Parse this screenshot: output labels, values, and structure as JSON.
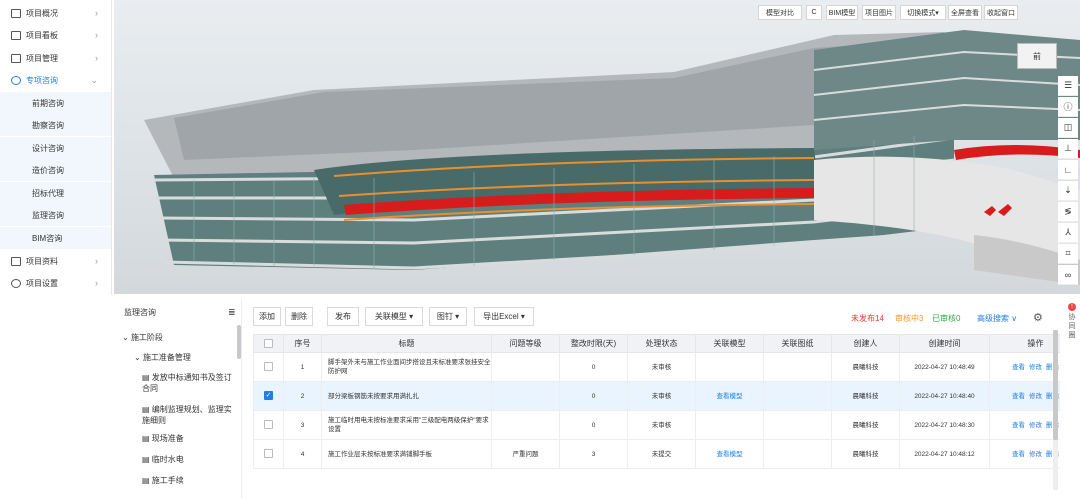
{
  "nav": {
    "items": [
      {
        "label": "项目概况",
        "icon": "building-icon"
      },
      {
        "label": "项目看板",
        "icon": "board-icon"
      },
      {
        "label": "项目管理",
        "icon": "chart-icon"
      },
      {
        "label": "专项咨询",
        "icon": "chat-icon"
      }
    ],
    "sub_items": [
      "前期咨询",
      "勘察咨询",
      "设计咨询",
      "造价咨询",
      "招标代理",
      "监理咨询",
      "BIM咨询"
    ],
    "bottom_items": [
      {
        "label": "项目资料",
        "icon": "book-icon"
      },
      {
        "label": "项目设置",
        "icon": "settings-icon"
      }
    ]
  },
  "viewer": {
    "toolbar": [
      "模型对比",
      "C",
      "BIM模型",
      "项目图片",
      "切换模式▾",
      "全屏查看",
      "收起窗口"
    ],
    "cube_label": "前"
  },
  "tree": {
    "title": "监理咨询",
    "nodes": [
      "施工阶段",
      "施工准备管理",
      "发放中标通知书及签订合同",
      "编制监理规划、监理实施细则",
      "现场准备",
      "临时水电",
      "施工手续"
    ]
  },
  "table_toolbar": {
    "buttons": [
      "添加",
      "删除",
      "发布",
      "关联模型 ▾",
      "图钉 ▾",
      "导出Excel ▾"
    ],
    "status": [
      {
        "label": "未发布14",
        "color": "#e53935"
      },
      {
        "label": "审核中3",
        "color": "#f59a23"
      },
      {
        "label": "已审核0",
        "color": "#2eaa4a"
      }
    ],
    "advanced_search": "高级搜索 ∨"
  },
  "table": {
    "headers": [
      "序号",
      "标题",
      "问题等级",
      "整改时限(天)",
      "处理状态",
      "关联模型",
      "关联图纸",
      "创建人",
      "创建时间",
      "操作"
    ],
    "rows": [
      {
        "no": "1",
        "title": "脚手架外未与施工作业面间步搭设且未标准要求张挂安全防护网",
        "level": "",
        "days": "0",
        "status": "未审核",
        "model": "",
        "drawing": "",
        "creator": "晨曦科技",
        "time": "2022-04-27 10:48:49",
        "checked": false
      },
      {
        "no": "2",
        "title": "部分梁板钢筋未按要求用满扎扎",
        "level": "",
        "days": "0",
        "status": "未审核",
        "model": "查看模型",
        "drawing": "",
        "creator": "晨曦科技",
        "time": "2022-04-27 10:48:40",
        "checked": true
      },
      {
        "no": "3",
        "title": "施工临时用电未按标准要求采用\"三级配电两级保护\"要求设置",
        "level": "",
        "days": "0",
        "status": "未审核",
        "model": "",
        "drawing": "",
        "creator": "晨曦科技",
        "time": "2022-04-27 10:48:30",
        "checked": false
      },
      {
        "no": "4",
        "title": "施工作业层未按标准要求满铺脚手板",
        "level": "严重问题",
        "days": "3",
        "status": "未提交",
        "model": "查看模型",
        "drawing": "",
        "creator": "晨曦科技",
        "time": "2022-04-27 10:48:12",
        "checked": false
      }
    ],
    "actions": [
      "查看",
      "修改",
      "删除"
    ]
  },
  "edge_tip": [
    "协",
    "同",
    "圈"
  ]
}
